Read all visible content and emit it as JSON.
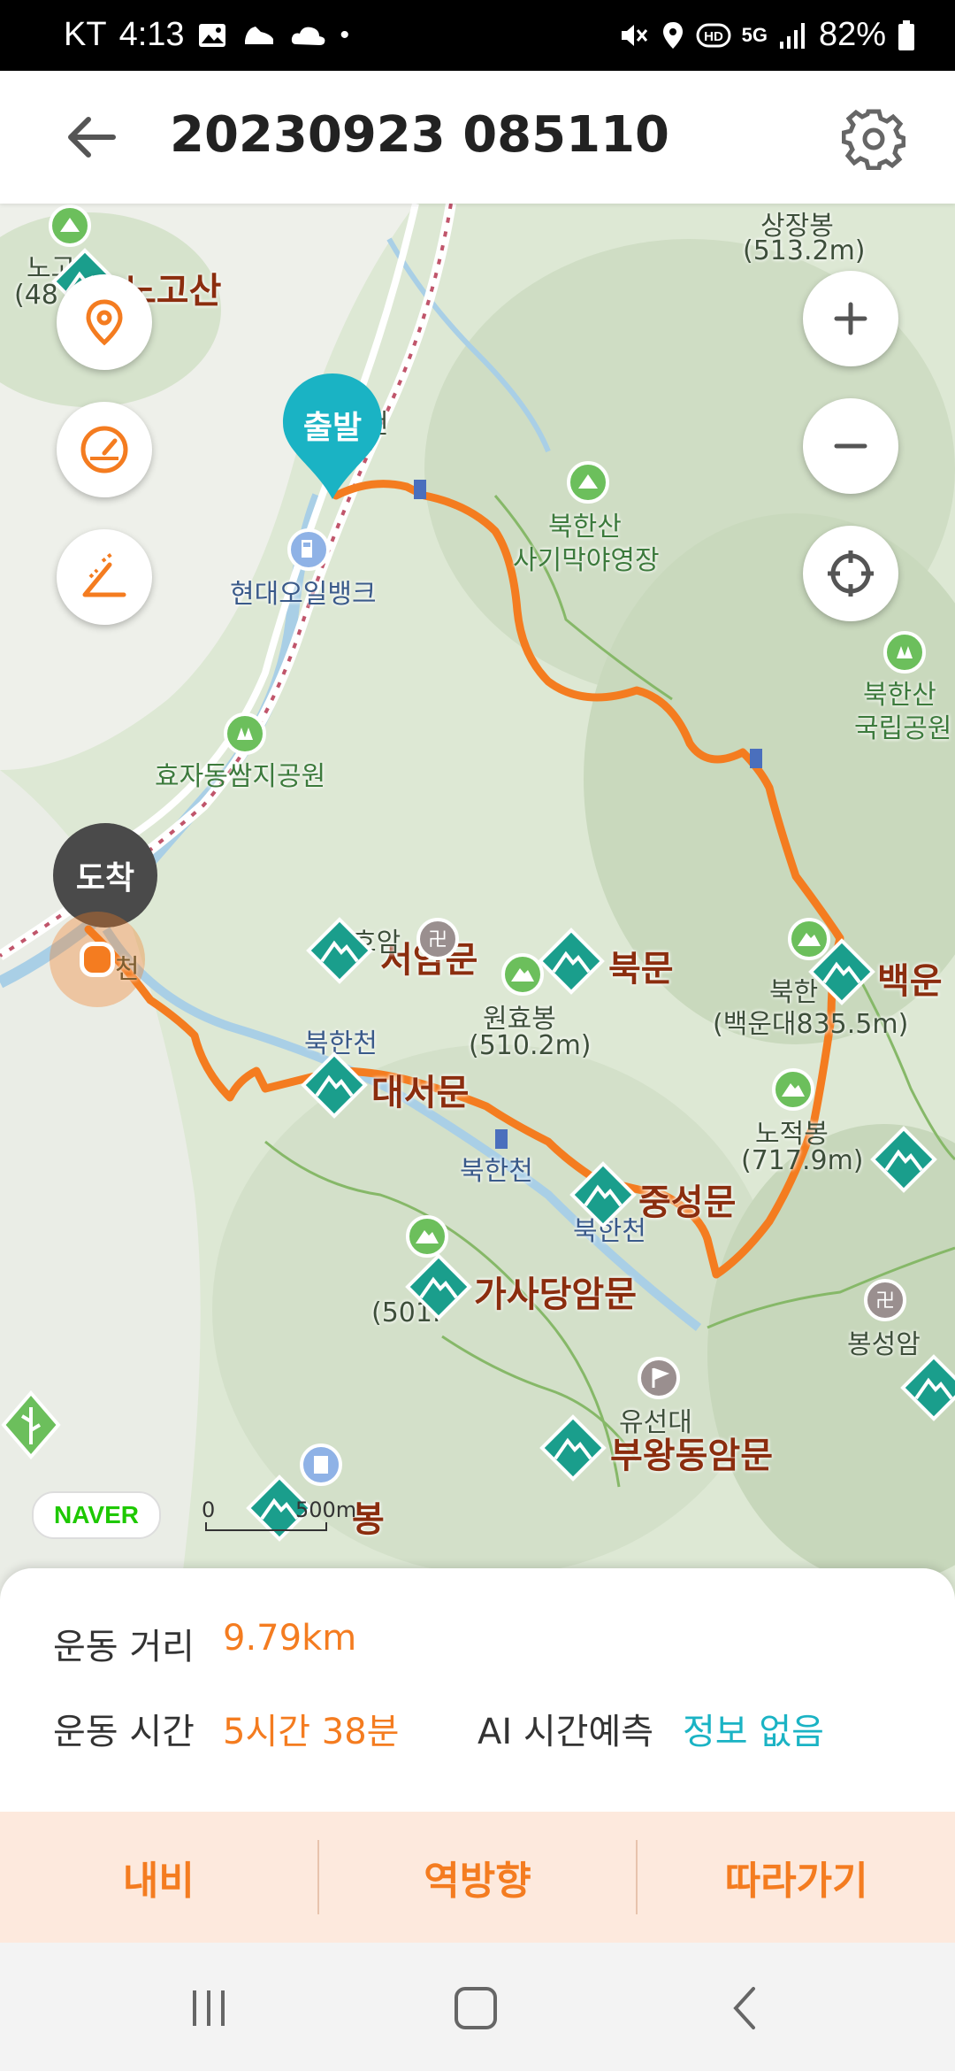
{
  "status_bar": {
    "carrier": "KT",
    "time": "4:13",
    "network": "5G",
    "battery": "82%"
  },
  "header": {
    "title": "20230923 085110",
    "back_icon": "arrow-left-icon",
    "settings_icon": "gear-icon"
  },
  "map": {
    "start_marker": "출발",
    "end_marker": "도착",
    "labels": {
      "nogosan": "노고산",
      "nogo_partial": "노고",
      "nogo_elev": "(48",
      "sangjangbong": "상장봉",
      "sangjangbong_elev": "(513.2m)",
      "camp_1": "북한산",
      "camp_2": "사기막야영장",
      "gas_station": "현대오일뱅크",
      "park_1": "북한산",
      "park_2": "국립공원",
      "hyoja_park": "효자동쌈지공원",
      "seoammun": "서암문",
      "bukmun": "북문",
      "wonhyobong": "원효봉",
      "wonhyobong_elev": "(510.2m)",
      "baegundae_gate": "백운",
      "baegundae_1": "북한",
      "baegundae_elev": "(백운대835.5m)",
      "bukhancheon_a": "북한천",
      "daeseomun": "대서문",
      "nojeokbong": "노적봉",
      "nojeokbong_elev": "(717.9m)",
      "bukhancheon_b": "북한천",
      "jungseongmun": "중성문",
      "bukhancheon_c": "북한천",
      "gasadang": "가사당암문",
      "uisangbong_elev": "(501.",
      "bongseongam": "봉성암",
      "yuseondae": "유선대",
      "buwangdong": "부왕동암문",
      "bottom_peak": "봉",
      "cheon": "천",
      "cheon2": "천",
      "hoam": "호암"
    },
    "naver_logo": "NAVER",
    "scale_zero": "0",
    "scale_value": "500m",
    "route_color": "#f47c20",
    "accent_cyan": "#1ab3c4"
  },
  "controls": {
    "location_icon": "location-pin-icon",
    "speed_icon": "speedometer-icon",
    "elevation_icon": "elevation-icon",
    "zoom_in_icon": "plus-icon",
    "zoom_out_icon": "minus-icon",
    "recenter_icon": "crosshair-icon"
  },
  "stats": {
    "distance_label": "운동 거리",
    "distance_value": "9.79km",
    "time_label": "운동 시간",
    "time_value": "5시간 38분",
    "ai_label": "AI 시간예측",
    "ai_value": "정보 없음"
  },
  "actions": {
    "navi": "내비",
    "reverse": "역방향",
    "follow": "따라가기"
  },
  "nav_bar": {
    "recents_icon": "recents-icon",
    "home_icon": "home-icon",
    "back_icon": "back-icon"
  }
}
